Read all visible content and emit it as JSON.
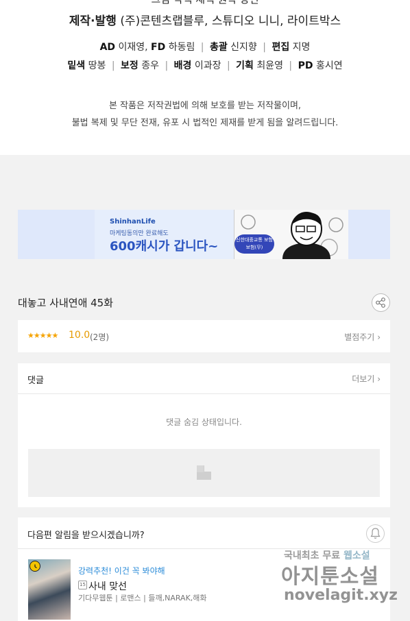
{
  "credits": {
    "top_line": "그림·각색·채색·원작·장편",
    "publisher_label": "제작·발행",
    "publisher_value": "(주)콘텐츠랩블루, 스튜디오 니니, 라이트박스",
    "staff_row1": [
      {
        "role": "AD",
        "name": "이재영,"
      },
      {
        "role": "FD",
        "name": "하동림"
      },
      {
        "role": "총괄",
        "name": "신지향"
      },
      {
        "role": "편집",
        "name": "지명"
      }
    ],
    "staff_row2": [
      {
        "role": "밑색",
        "name": "땅봉"
      },
      {
        "role": "보정",
        "name": "종우"
      },
      {
        "role": "배경",
        "name": "이과장"
      },
      {
        "role": "기획",
        "name": "최윤영"
      },
      {
        "role": "PD",
        "name": "홍시연"
      }
    ],
    "separator": "|",
    "notice_line1": "본 작품은 저작권법에 의해 보호를 받는 저작물이며,",
    "notice_line2": "불법 복제 및 무단 전재, 유포 시 법적인 제재를 받게 됨을 알려드립니다."
  },
  "ad": {
    "brand": "ShinhanLife",
    "subtitle": "마케팅동의만 완료해도",
    "headline": "600캐시가 갑니다~",
    "badge": "신한대중교통 보험보험(무)"
  },
  "episode": {
    "title": "대놓고 사내연애 45화"
  },
  "rating": {
    "stars": "★★★★★",
    "score": "10.0",
    "votes": "(2명)",
    "rate_label": "별점주기"
  },
  "comments": {
    "title": "댓글",
    "more_label": "더보기",
    "hidden_message": "댓글 숨김 상태입니다."
  },
  "next_episode": {
    "prompt": "다음편 알림을 받으시겠습니까?",
    "recommend_label": "강력추천! 이건 꼭 봐야해",
    "age_badge": "15",
    "series_title": "사내 맞선",
    "series_meta": "기다무웹툰 | 로맨스 | 들깨,NARAK,해화"
  },
  "watermark": {
    "line1_a": "국내최초 무료",
    "line1_b": "웹소설",
    "line2": "아지툰소설",
    "line3": "novelagit.xyz"
  },
  "colors": {
    "accent_star": "#f5a300",
    "link_blue": "#2a8bd8",
    "ad_blue": "#2a54c0"
  }
}
